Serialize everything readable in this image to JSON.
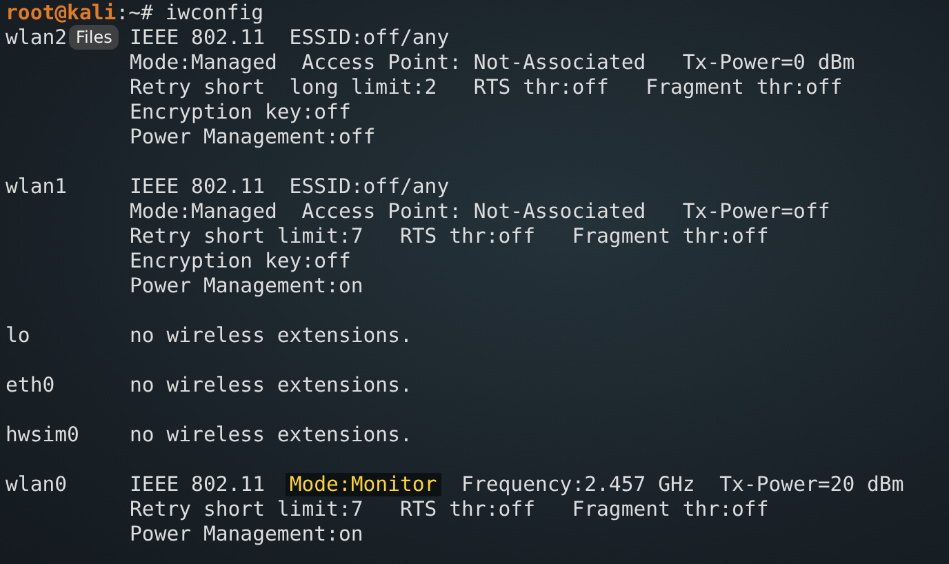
{
  "tooltip": {
    "label": "Files"
  },
  "prompt": {
    "user_host": "root@kali",
    "command": ":~# iwconfig"
  },
  "interfaces": [
    {
      "name": "wlan2",
      "lines": [
        [
          {
            "text": "IEEE 802.11  ESSID:off/any",
            "highlighted": false
          }
        ],
        [
          {
            "text": "Mode:Managed  Access Point: Not-Associated   Tx-Power=0 dBm",
            "highlighted": false
          }
        ],
        [
          {
            "text": "Retry short  long limit:2   RTS thr:off   Fragment thr:off",
            "highlighted": false
          }
        ],
        [
          {
            "text": "Encryption key:off",
            "highlighted": false
          }
        ],
        [
          {
            "text": "Power Management:off",
            "highlighted": false
          }
        ]
      ]
    },
    {
      "name": "wlan1",
      "lines": [
        [
          {
            "text": "IEEE 802.11  ESSID:off/any",
            "highlighted": false
          }
        ],
        [
          {
            "text": "Mode:Managed  Access Point: Not-Associated   Tx-Power=off",
            "highlighted": false
          }
        ],
        [
          {
            "text": "Retry short limit:7   RTS thr:off   Fragment thr:off",
            "highlighted": false
          }
        ],
        [
          {
            "text": "Encryption key:off",
            "highlighted": false
          }
        ],
        [
          {
            "text": "Power Management:on",
            "highlighted": false
          }
        ]
      ]
    },
    {
      "name": "lo",
      "lines": [
        [
          {
            "text": "no wireless extensions.",
            "highlighted": false
          }
        ]
      ]
    },
    {
      "name": "eth0",
      "lines": [
        [
          {
            "text": "no wireless extensions.",
            "highlighted": false
          }
        ]
      ]
    },
    {
      "name": "hwsim0",
      "lines": [
        [
          {
            "text": "no wireless extensions.",
            "highlighted": false
          }
        ]
      ]
    },
    {
      "name": "wlan0",
      "lines": [
        [
          {
            "text": "IEEE 802.11  ",
            "highlighted": false
          },
          {
            "text": "Mode:Monitor",
            "highlighted": true
          },
          {
            "text": "  Frequency:2.457 GHz  Tx-Power=20 dBm",
            "highlighted": false
          }
        ],
        [
          {
            "text": "Retry short limit:7   RTS thr:off   Fragment thr:off",
            "highlighted": false
          }
        ],
        [
          {
            "text": "Power Management:on",
            "highlighted": false
          }
        ]
      ]
    }
  ]
}
